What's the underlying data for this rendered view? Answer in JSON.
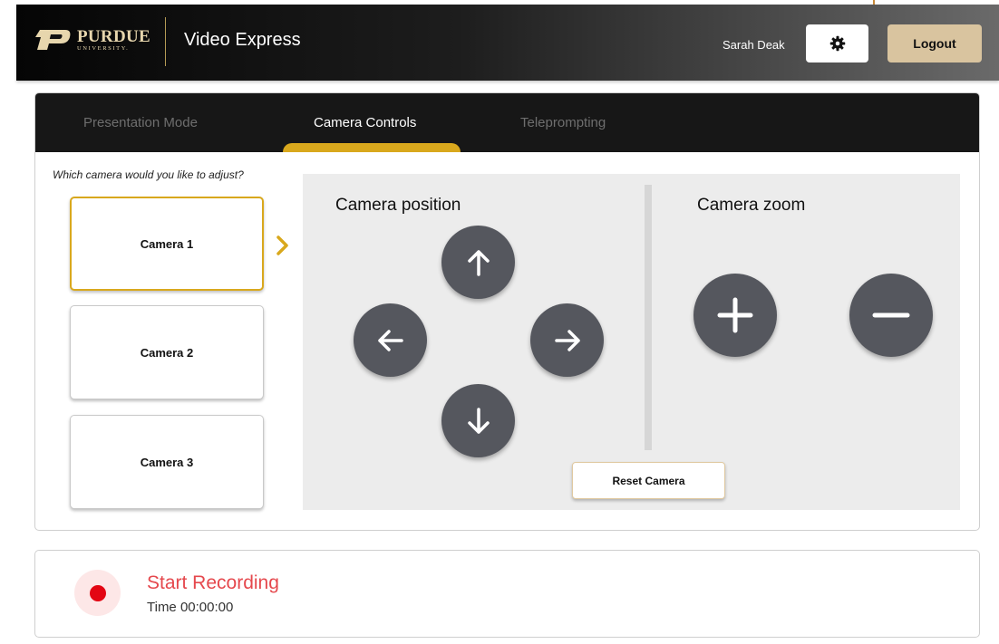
{
  "header": {
    "logo": {
      "word": "PURDUE",
      "subword": "UNIVERSITY."
    },
    "app_title": "Video Express",
    "user_name": "Sarah Deak",
    "settings_icon": "gear-icon",
    "logout_label": "Logout"
  },
  "tabs": [
    {
      "label": "Presentation Mode",
      "active": false
    },
    {
      "label": "Camera Controls",
      "active": true
    },
    {
      "label": "Teleprompting",
      "active": false
    }
  ],
  "camera_select": {
    "prompt": "Which camera would you like to adjust?",
    "cameras": [
      {
        "label": "Camera 1",
        "selected": true
      },
      {
        "label": "Camera 2",
        "selected": false
      },
      {
        "label": "Camera 3",
        "selected": false
      }
    ]
  },
  "position": {
    "heading": "Camera position",
    "buttons": [
      "arrow-up-icon",
      "arrow-left-icon",
      "arrow-right-icon",
      "arrow-down-icon"
    ]
  },
  "zoom": {
    "heading": "Camera zoom",
    "buttons": [
      "plus-icon",
      "minus-icon"
    ]
  },
  "reset_label": "Reset Camera",
  "recording": {
    "title": "Start Recording",
    "time": "Time 00:00:00"
  },
  "colors": {
    "accent_gold": "#d9a81d",
    "logout_bg": "#d9c49f",
    "control_button": "#55575e",
    "panel_bg": "#ececec",
    "record_red": "#e30613",
    "record_text": "#e5484d"
  }
}
